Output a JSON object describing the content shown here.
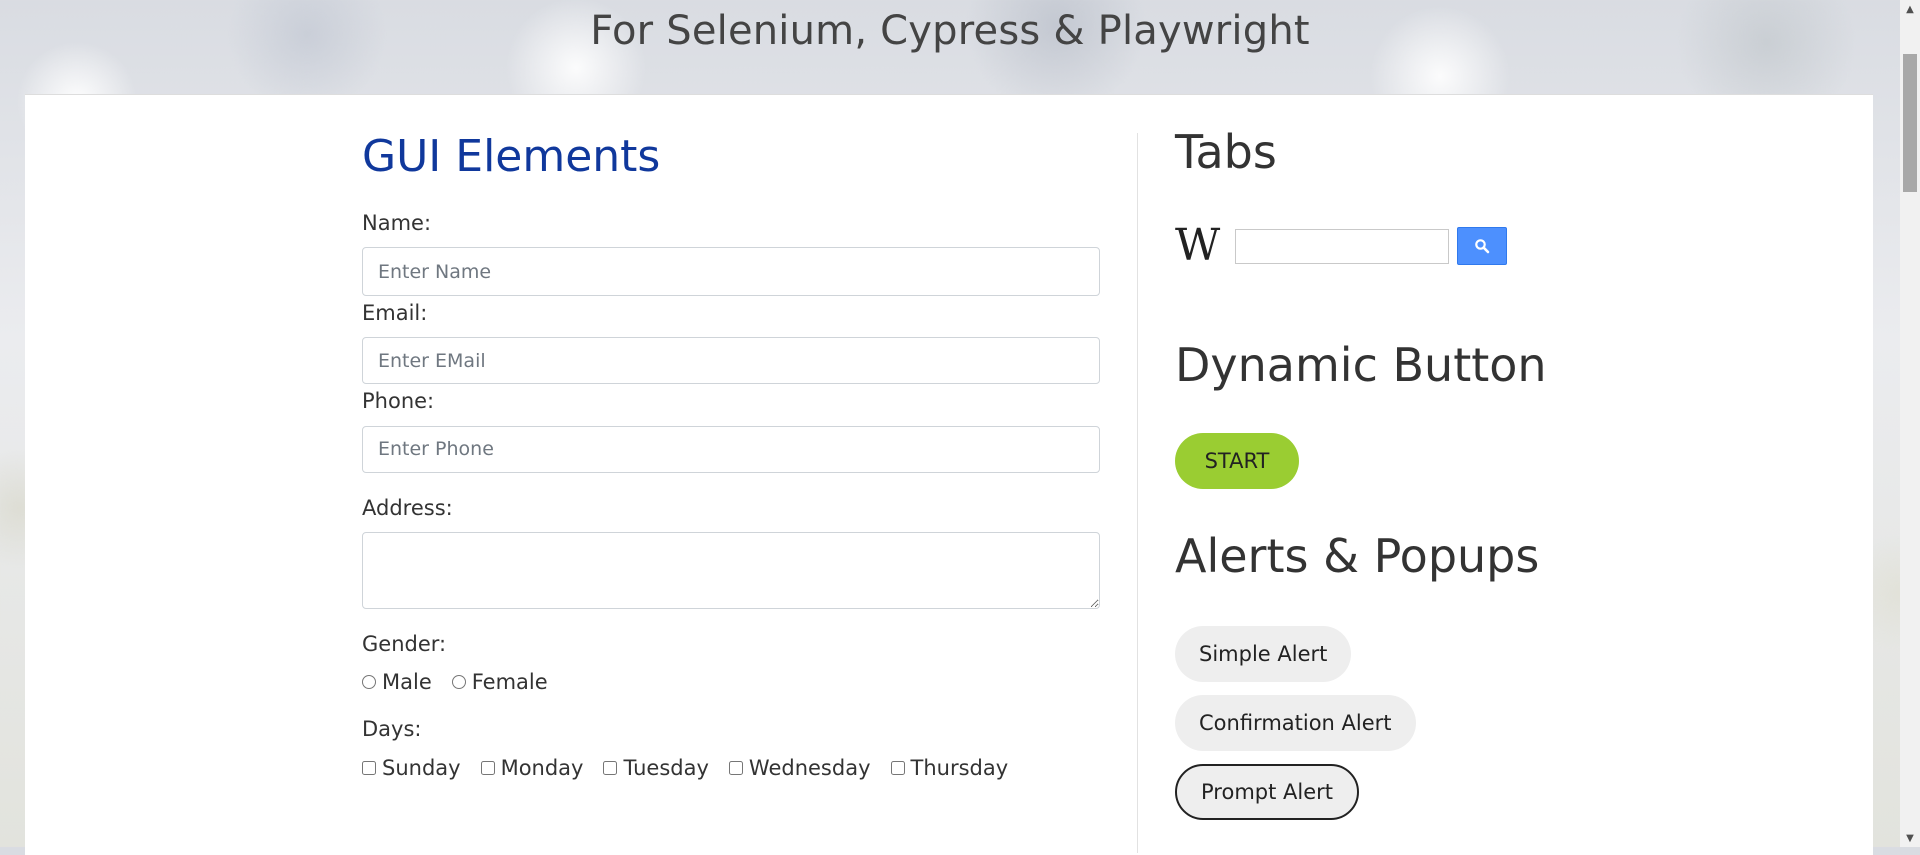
{
  "header": {
    "title": "For Selenium, Cypress & Playwright"
  },
  "gui": {
    "title": "GUI Elements",
    "name": {
      "label": "Name:",
      "placeholder": "Enter Name"
    },
    "email": {
      "label": "Email:",
      "placeholder": "Enter EMail"
    },
    "phone": {
      "label": "Phone:",
      "placeholder": "Enter Phone"
    },
    "address": {
      "label": "Address:"
    },
    "gender": {
      "label": "Gender:",
      "options": [
        "Male",
        "Female"
      ]
    },
    "days": {
      "label": "Days:",
      "options": [
        "Sunday",
        "Monday",
        "Tuesday",
        "Wednesday",
        "Thursday"
      ]
    }
  },
  "tabs": {
    "title": "Tabs"
  },
  "wikipedia": {
    "logo": "W",
    "search_icon": "search-icon",
    "button_color": "#4d90fe"
  },
  "dynamic": {
    "title": "Dynamic Button",
    "start_label": "START",
    "start_color": "#9acd32"
  },
  "alerts": {
    "title": "Alerts & Popups",
    "buttons": [
      "Simple Alert",
      "Confirmation Alert",
      "Prompt Alert"
    ]
  },
  "colors": {
    "section_title": "#10389c"
  }
}
